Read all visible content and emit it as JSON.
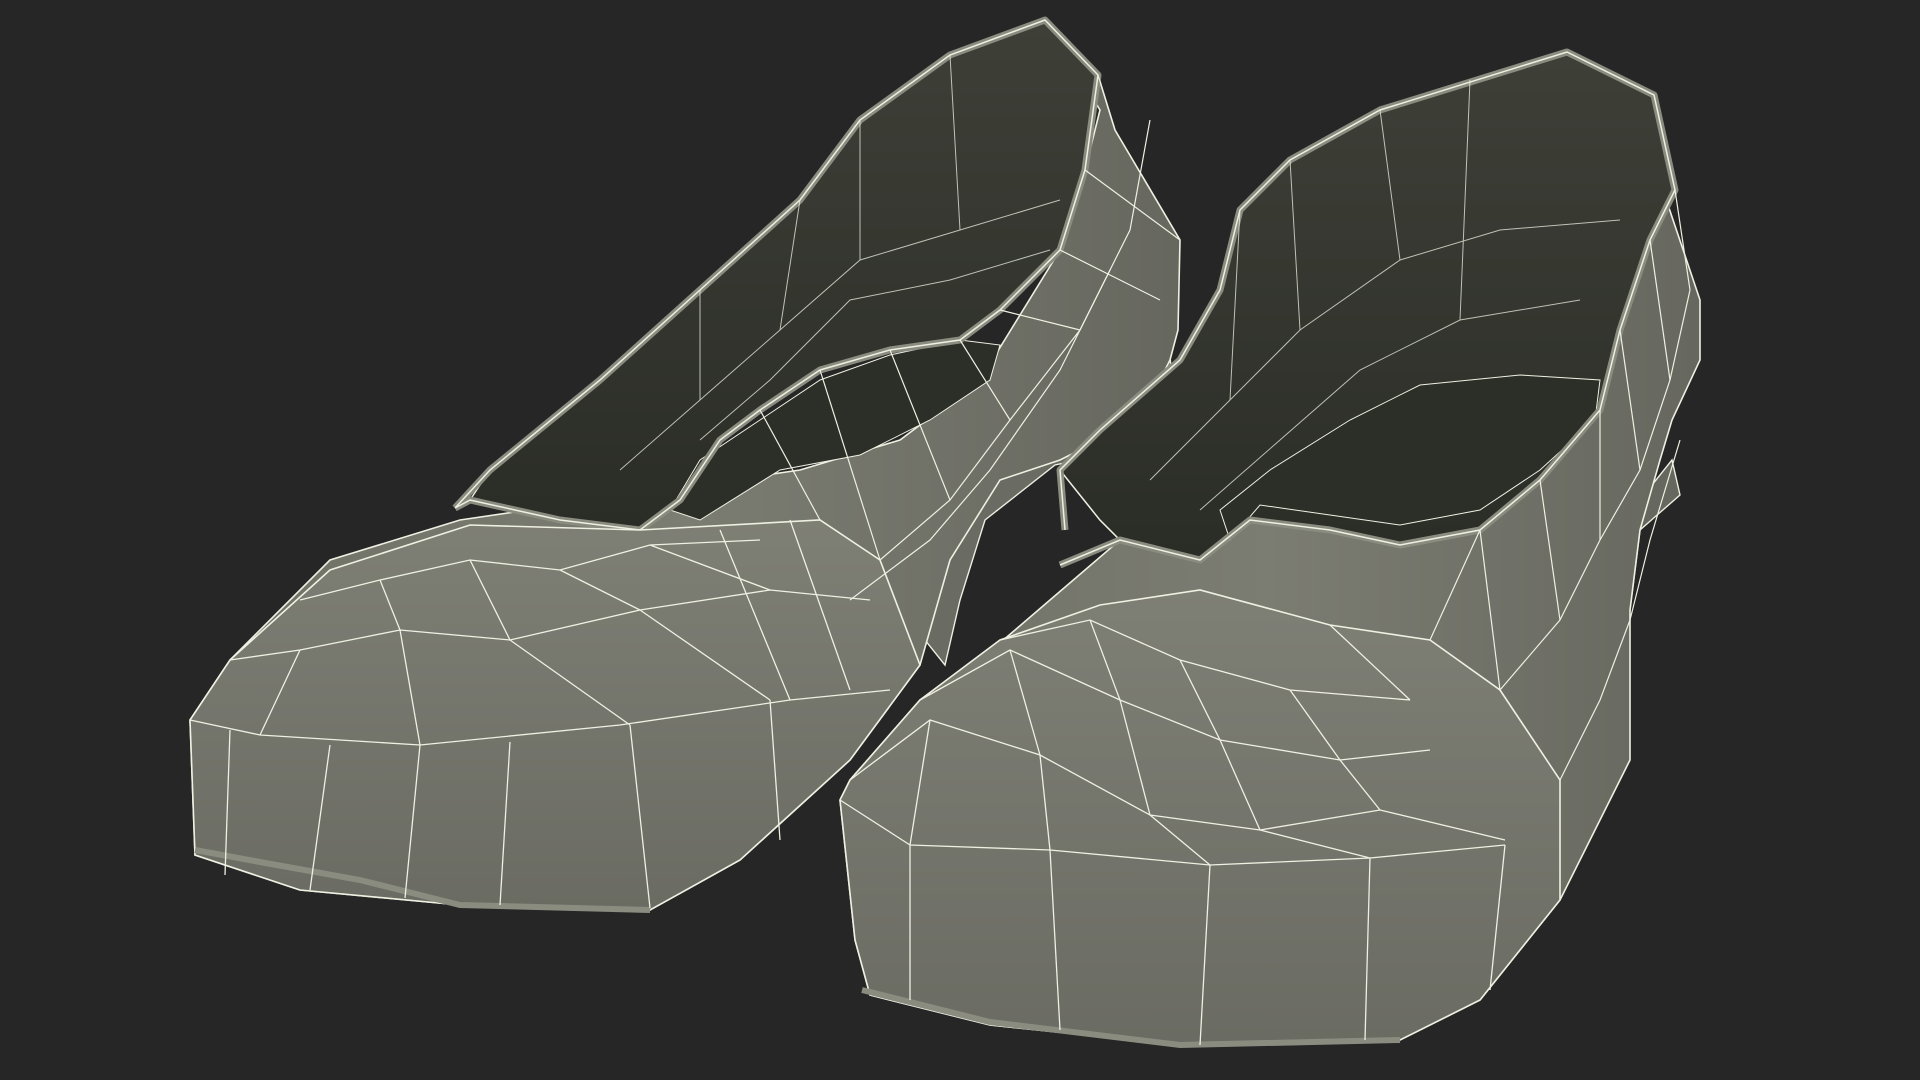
{
  "scene": {
    "subject": "pair-of-wireframe-pumps",
    "colors": {
      "background": "#262626",
      "surface": "#77786e",
      "surface_shade": "#5f6058",
      "interior": "#3a3c34",
      "interior_deep": "#2c2e28",
      "wire": "#eef0e2",
      "rim": "#8b8c80"
    }
  }
}
